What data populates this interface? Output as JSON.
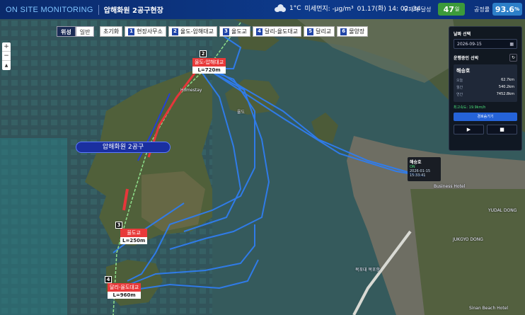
{
  "header": {
    "brand": "ON SITE MONITORING",
    "site_title": "압해화원 2공구현장",
    "temperature": "1°C",
    "dust": "미세먼지: -μg/m³",
    "datetime": "01.17(화) 14: 02: 34",
    "safety_label": "무재해 달성",
    "safety_days": "47",
    "safety_unit": "일",
    "progress_label": "공정률",
    "progress_value": "93.6",
    "progress_unit": "%"
  },
  "map": {
    "zoom_in": "+",
    "zoom_out": "−",
    "compass": "▲",
    "mode_satellite": "위성",
    "mode_general": "일반",
    "reset": "초기화",
    "locations": [
      {
        "num": "1",
        "label": "현장사무소"
      },
      {
        "num": "2",
        "label": "율도-압해대교"
      },
      {
        "num": "3",
        "label": "율도교"
      },
      {
        "num": "4",
        "label": "달리-율도대교"
      },
      {
        "num": "5",
        "label": "달리교"
      },
      {
        "num": "6",
        "label": "물양장"
      }
    ],
    "site_label": "압해화원 2공구",
    "bridges": [
      {
        "num": "2",
        "name": "율도-압해대교",
        "length": "L=720m"
      },
      {
        "num": "3",
        "name": "율도교",
        "length": "L=250m"
      },
      {
        "num": "4",
        "name": "달리-율도대교",
        "length": "L=960m"
      }
    ],
    "place_labels": {
      "business_hotel": "Business Hotel",
      "bukhang_port": "목포대 목포항",
      "sinan_beach": "Sinan Beach Hotel",
      "yudal_dong": "YUDAL DONG",
      "jukgyo_dong": "JUKGYO DONG",
      "yuldo": "율도",
      "homestay": "Homestay"
    },
    "vessel_popup": {
      "name": "해승호",
      "status": "ON",
      "time": "2026-01-15 15:33:41"
    }
  },
  "panel": {
    "date_title": "날짜 선택",
    "date_value": "2026-09-15",
    "vessel_title": "운행중인 선박",
    "vessel_name": "해승호",
    "stats": [
      {
        "k": "오늘",
        "v": "62.7km"
      },
      {
        "k": "월간",
        "v": "540.2km"
      },
      {
        "k": "연간",
        "v": "7452.8km"
      }
    ],
    "max_speed": "최고속도: 19.9km/h",
    "route_button": "경로숨기기",
    "play": "▶",
    "stop": "■"
  }
}
